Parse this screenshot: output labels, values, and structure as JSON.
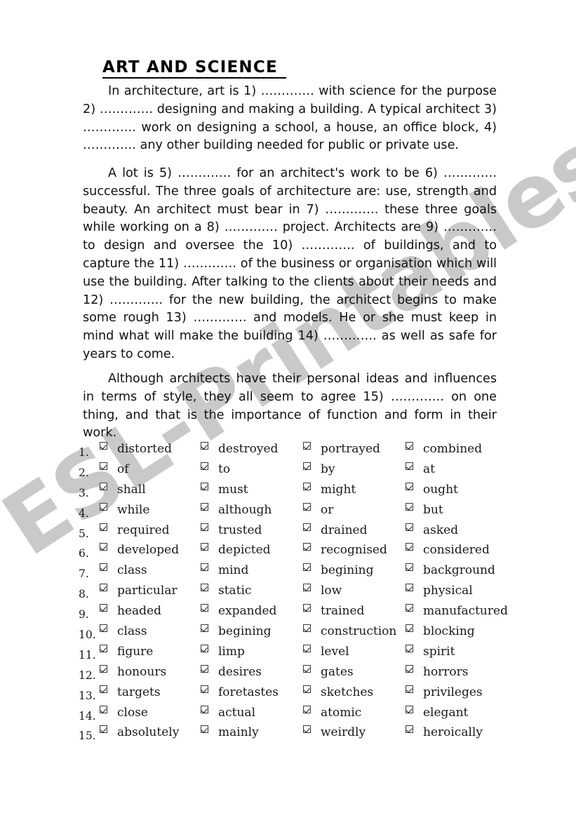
{
  "worksheet": {
    "title": "ART AND SCIENCE",
    "watermark": "ESL-Printables.com"
  },
  "passage": {
    "paragraph1": "In architecture, art is  1) …………. with science for the purpose 2)  …………. designing and making a building.   A typical architect 3)  …………. work on designing a school, a house, an office block, 4)  …………. any other building needed for public or private use.",
    "paragraph2": "A lot is  5) …………. for an architect's work to be  6) …………. successful. The three goals of architecture are: use, strength and beauty.  An architect must bear in 7) …………. these three goals while working on a  8) …………. project.  Architects are  9) …………. to design and oversee the 10) …………. of buildings, and to capture the 11)  …………. of the business or organisation which will use the building.  After talking to the clients about their needs and 12) …………. for the new building, the architect begins to make some rough 13) …………. and models. He or she must keep in mind what will make the building 14)  ………….  as well as safe for years to come.",
    "paragraph3": "Although architects have their personal ideas and influences in terms of style, they all seem to agree 15) …………. on one thing, and that is the importance of function and form in their work."
  },
  "options": {
    "checkbox_icon": "checked-checkbox-icon",
    "rows": [
      {
        "number": "1.",
        "choices": [
          "distorted",
          "destroyed",
          "portrayed",
          "combined"
        ]
      },
      {
        "number": "2.",
        "choices": [
          "of",
          "to",
          "by",
          "at"
        ]
      },
      {
        "number": "3.",
        "choices": [
          "shall",
          "must",
          "might",
          "ought"
        ]
      },
      {
        "number": "4.",
        "choices": [
          "while",
          "although",
          "or",
          "but"
        ]
      },
      {
        "number": "5.",
        "choices": [
          "required",
          "trusted",
          "drained",
          "asked"
        ]
      },
      {
        "number": "6.",
        "choices": [
          "developed",
          "depicted",
          "recognised",
          "considered"
        ]
      },
      {
        "number": "7.",
        "choices": [
          "class",
          "mind",
          "begining",
          "background"
        ]
      },
      {
        "number": "8.",
        "choices": [
          "particular",
          "static",
          "low",
          "physical"
        ]
      },
      {
        "number": "9.",
        "choices": [
          "headed",
          "expanded",
          "trained",
          "manufactured"
        ]
      },
      {
        "number": "10.",
        "choices": [
          "class",
          "begining",
          "construction",
          "blocking"
        ]
      },
      {
        "number": "11.",
        "choices": [
          "figure",
          "limp",
          "level",
          "spirit"
        ]
      },
      {
        "number": "12.",
        "choices": [
          "honours",
          "desires",
          "gates",
          "horrors"
        ]
      },
      {
        "number": "13.",
        "choices": [
          "targets",
          "foretastes",
          "sketches",
          "privileges"
        ]
      },
      {
        "number": "14.",
        "choices": [
          "close",
          "actual",
          "atomic",
          "elegant"
        ]
      },
      {
        "number": "15.",
        "choices": [
          "absolutely",
          "mainly",
          "weirdly",
          "heroically"
        ]
      }
    ]
  },
  "colors": {
    "text": "#111111",
    "watermark": "#c9c9c9",
    "page": "#ffffff"
  }
}
